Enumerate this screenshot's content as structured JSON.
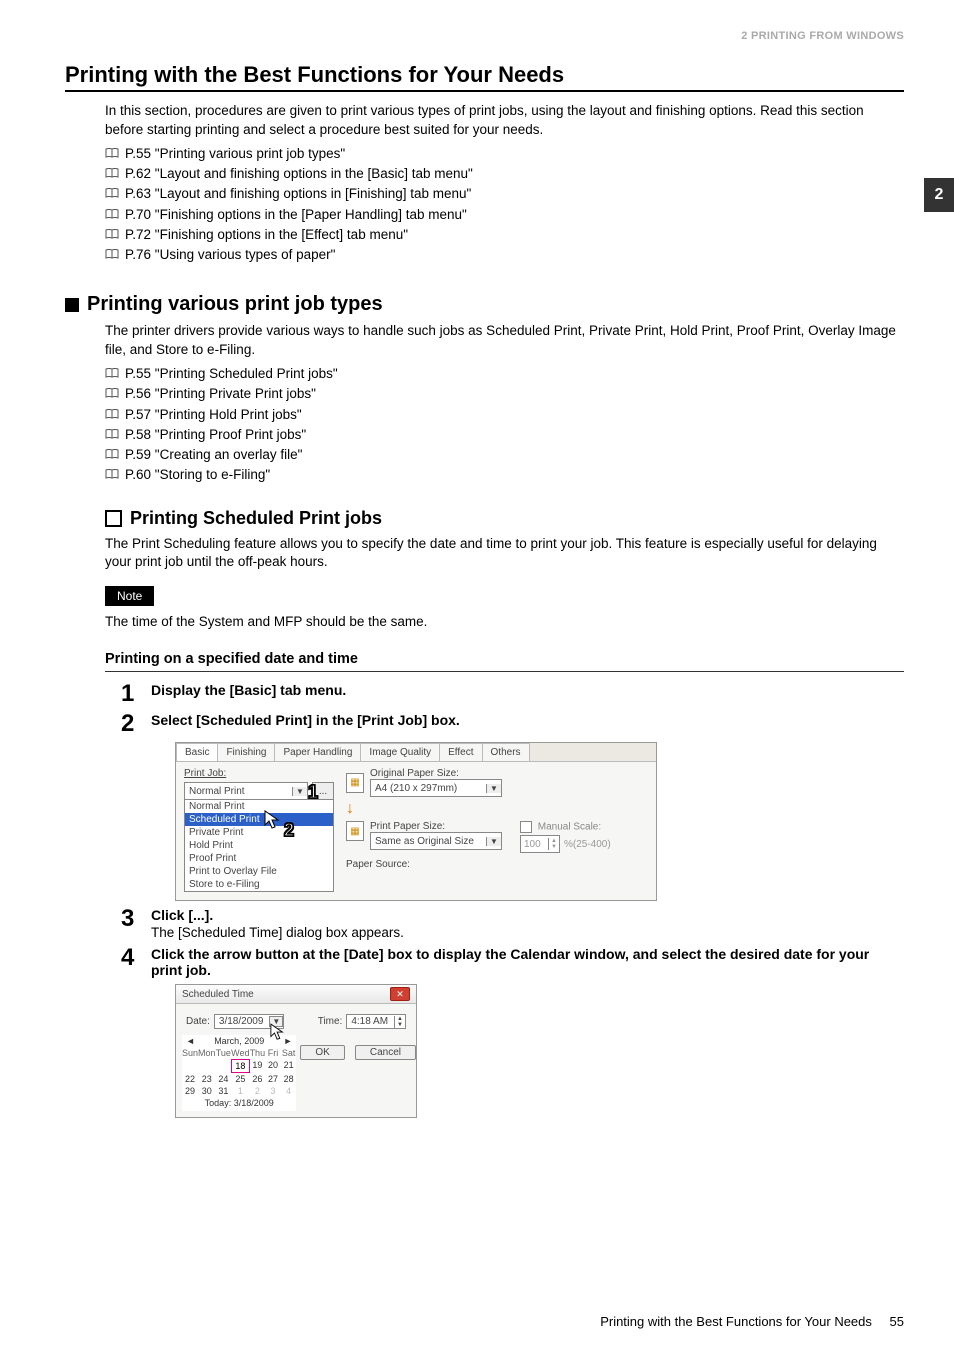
{
  "headerBand": "2 PRINTING FROM WINDOWS",
  "sideTab": "2",
  "title": "Printing with the Best Functions for Your Needs",
  "intro": "In this section, procedures are given to print various types of print jobs, using the layout and finishing options. Read this section before starting printing and select a procedure best suited for your needs.",
  "refs1": [
    "P.55 \"Printing various print job types\"",
    "P.62 \"Layout and finishing options in the [Basic] tab menu\"",
    "P.63 \"Layout and finishing options in [Finishing] tab menu\"",
    "P.70 \"Finishing options in the [Paper Handling] tab menu\"",
    "P.72 \"Finishing options in the [Effect] tab menu\"",
    "P.76 \"Using various types of paper\""
  ],
  "sub1Title": "Printing various print job types",
  "sub1Intro": "The printer drivers provide various ways to handle such jobs as Scheduled Print, Private Print, Hold Print, Proof Print, Overlay Image file, and Store to e-Filing.",
  "refs2": [
    "P.55 \"Printing Scheduled Print jobs\"",
    "P.56 \"Printing Private Print jobs\"",
    "P.57 \"Printing Hold Print jobs\"",
    "P.58 \"Printing Proof Print jobs\"",
    "P.59 \"Creating an overlay file\"",
    "P.60 \"Storing to e-Filing\""
  ],
  "sub2Title": "Printing Scheduled Print jobs",
  "sub2Body": "The Print Scheduling feature allows you to specify the date and time to print your job. This feature is especially useful for delaying your print job until the off-peak hours.",
  "noteLabel": "Note",
  "noteText": "The time of the System and MFP should be the same.",
  "procTitle": "Printing on a specified date and time",
  "steps": {
    "s1": "Display the [Basic] tab menu.",
    "s2": "Select [Scheduled Print] in the [Print Job] box.",
    "s3": "Click [...].",
    "s3sub": "The [Scheduled Time] dialog box appears.",
    "s4": "Click the arrow button at the [Date] box to display the Calendar window, and select the desired date for your print job."
  },
  "shot1": {
    "tabs": [
      "Basic",
      "Finishing",
      "Paper Handling",
      "Image Quality",
      "Effect",
      "Others"
    ],
    "printJobLabel": "Print Job:",
    "comboValue": "Normal Print",
    "dropdown": [
      "Normal Print",
      "Scheduled Print",
      "Private Print",
      "Hold Print",
      "Proof Print",
      "Print to Overlay File",
      "Store to e-Filing"
    ],
    "origPaperLabel": "Original Paper Size:",
    "origPaperValue": "A4 (210 x 297mm)",
    "printPaperLabel": "Print Paper Size:",
    "printPaperValue": "Same as Original Size",
    "manualScaleLabel": "Manual Scale:",
    "manualScaleValue": "100",
    "manualScaleRange": "%(25-400)",
    "paperSourceLabel": "Paper Source:"
  },
  "shot2": {
    "dialogTitle": "Scheduled Time",
    "dateLabel": "Date:",
    "dateValue": "3/18/2009",
    "timeLabel": "Time:",
    "timeValue": "4:18 AM",
    "monthHeader": "March, 2009",
    "dow": [
      "Sun",
      "Mon",
      "Tue",
      "Wed",
      "Thu",
      "Fri",
      "Sat"
    ],
    "todayLabel": "Today: 3/18/2009",
    "okLabel": "OK",
    "cancelLabel": "Cancel",
    "calendar_rows": [
      [
        "",
        "",
        "",
        "18",
        "19",
        "20",
        "21"
      ],
      [
        "22",
        "23",
        "24",
        "25",
        "26",
        "27",
        "28"
      ],
      [
        "29",
        "30",
        "31",
        "1",
        "2",
        "3",
        "4"
      ]
    ],
    "selected_day": "18",
    "trailing_gray_start_index": 17
  },
  "footerText": "Printing with the Best Functions for Your Needs",
  "pageNumber": "55"
}
